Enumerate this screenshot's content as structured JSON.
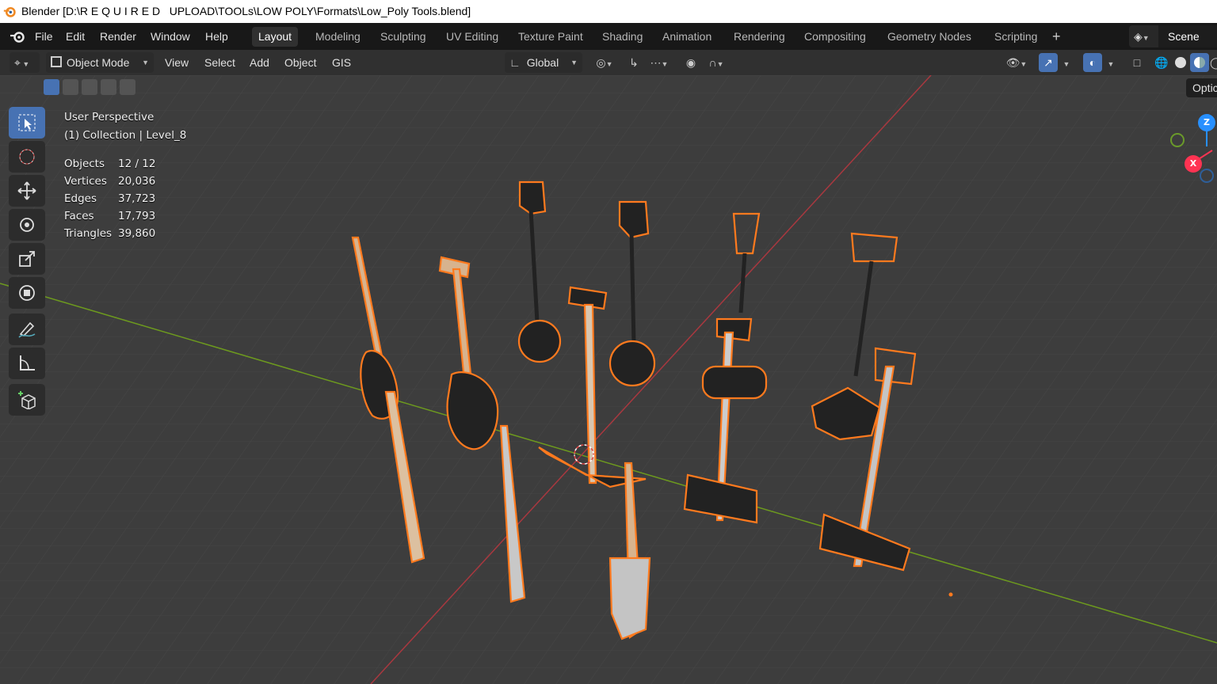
{
  "window": {
    "title": "Blender [D:\\R E Q U I R E D   UPLOAD\\TOOLs\\LOW POLY\\Formats\\Low_Poly Tools.blend]"
  },
  "menu": [
    "File",
    "Edit",
    "Render",
    "Window",
    "Help"
  ],
  "workspaces": {
    "active": "Layout",
    "tabs": [
      "Layout",
      "Modeling",
      "Sculpting",
      "UV Editing",
      "Texture Paint",
      "Shading",
      "Animation",
      "Rendering",
      "Compositing",
      "Geometry Nodes",
      "Scripting"
    ]
  },
  "scene": {
    "label": "Scene"
  },
  "header": {
    "mode": "Object Mode",
    "menus": [
      "View",
      "Select",
      "Add",
      "Object",
      "GIS"
    ],
    "orientation": "Global"
  },
  "viewport": {
    "perspective": "User Perspective",
    "collection": "(1) Collection | Level_8",
    "stats": [
      {
        "label": "Objects",
        "value": "12 / 12"
      },
      {
        "label": "Vertices",
        "value": "20,036"
      },
      {
        "label": "Edges",
        "value": "37,723"
      },
      {
        "label": "Faces",
        "value": "17,793"
      },
      {
        "label": "Triangles",
        "value": "39,860"
      }
    ],
    "options_label": "Optic"
  },
  "gizmo": {
    "z": "Z",
    "x": "X"
  },
  "icons": {
    "blender": "blender-logo-icon",
    "tools": [
      "select-box-icon",
      "cursor-icon",
      "move-icon",
      "rotate-icon",
      "scale-icon",
      "transform-icon",
      "annotate-icon",
      "measure-icon",
      "add-cube-icon"
    ]
  },
  "colors": {
    "accent": "#4772b3",
    "selection_outline": "#ff7a1e",
    "x_axis": "#ff3352",
    "y_axis": "#8bdc00",
    "z_axis": "#2890ff"
  }
}
